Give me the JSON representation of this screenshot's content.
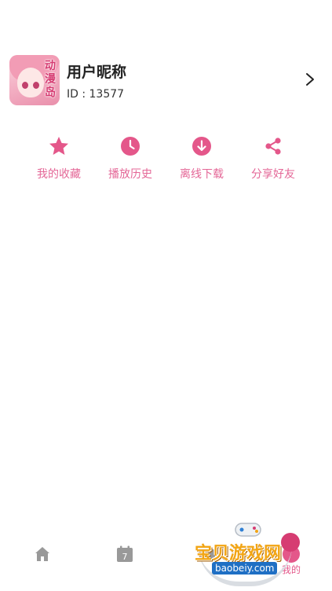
{
  "profile": {
    "avatar_text": "动漫岛",
    "nickname": "用户昵称",
    "user_id": "ID : 13577"
  },
  "actions": [
    {
      "icon": "star-icon",
      "label": "我的收藏"
    },
    {
      "icon": "clock-icon",
      "label": "播放历史"
    },
    {
      "icon": "download-icon",
      "label": "离线下载"
    },
    {
      "icon": "share-icon",
      "label": "分享好友"
    }
  ],
  "tabbar": {
    "tabs": [
      {
        "icon": "home-icon",
        "active": false
      },
      {
        "icon": "calendar-icon",
        "calendar_day": "7",
        "active": false
      },
      {
        "icon": "tab-icon",
        "active": false
      },
      {
        "icon": "profile-icon",
        "label": "我的",
        "active": true
      }
    ]
  },
  "watermark": {
    "title": "宝贝游戏网",
    "url": "baobeiy.com"
  },
  "colors": {
    "accent": "#e4578a",
    "icon_gray": "#999999",
    "text_dark": "#222222"
  }
}
